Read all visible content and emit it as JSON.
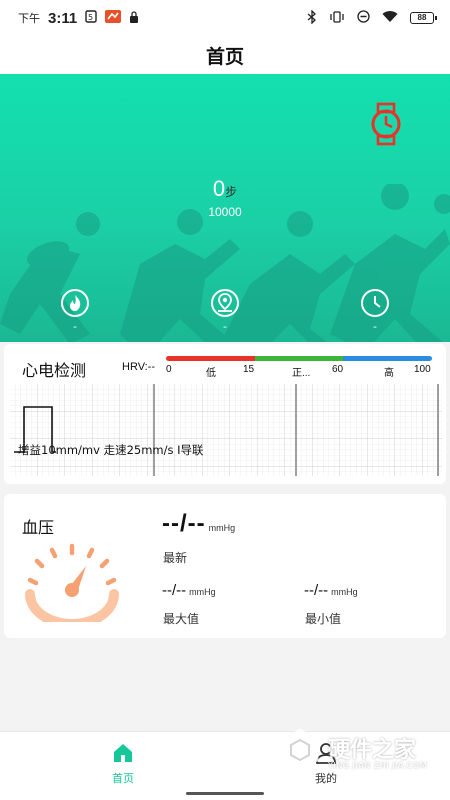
{
  "status_bar": {
    "period": "下午",
    "time": "3:11",
    "battery": "88"
  },
  "header": {
    "title": "首页"
  },
  "hero": {
    "steps_value": "0",
    "steps_unit": "步",
    "steps_goal": "10000",
    "metrics": [
      {
        "icon": "flame-icon",
        "value": "-"
      },
      {
        "icon": "location-pin-icon",
        "value": "-"
      },
      {
        "icon": "clock-icon",
        "value": "-"
      }
    ],
    "colors": {
      "top": "#13e0ae",
      "bottom": "#1ab893",
      "watch": "#e8322a"
    }
  },
  "ecg": {
    "title": "心电检测",
    "hrv_label": "HRV:--",
    "hrv_scale": {
      "ticks": [
        "0",
        "低",
        "15",
        "正...",
        "60",
        "高",
        "100"
      ],
      "colors": [
        "#e8322a",
        "#3cb53a",
        "#2a8ee0"
      ]
    },
    "info": "增益10mm/mv 走速25mm/s I导联"
  },
  "blood_pressure": {
    "title": "血压",
    "latest_value": "--/--",
    "latest_unit": "mmHg",
    "latest_label": "最新",
    "max_value": "--/--",
    "max_unit": "mmHg",
    "max_label": "最大值",
    "min_value": "--/--",
    "min_unit": "mmHg",
    "min_label": "最小值",
    "gauge_color": "#f7a071"
  },
  "bottom_nav": {
    "items": [
      {
        "label": "首页",
        "icon": "home-icon",
        "active": true
      },
      {
        "label": "我的",
        "icon": "person-icon",
        "active": false
      }
    ],
    "active_color": "#16c79a"
  },
  "watermark": {
    "text": "硬件之家",
    "sub": "YING JIAN ZHI JIA.COM"
  }
}
